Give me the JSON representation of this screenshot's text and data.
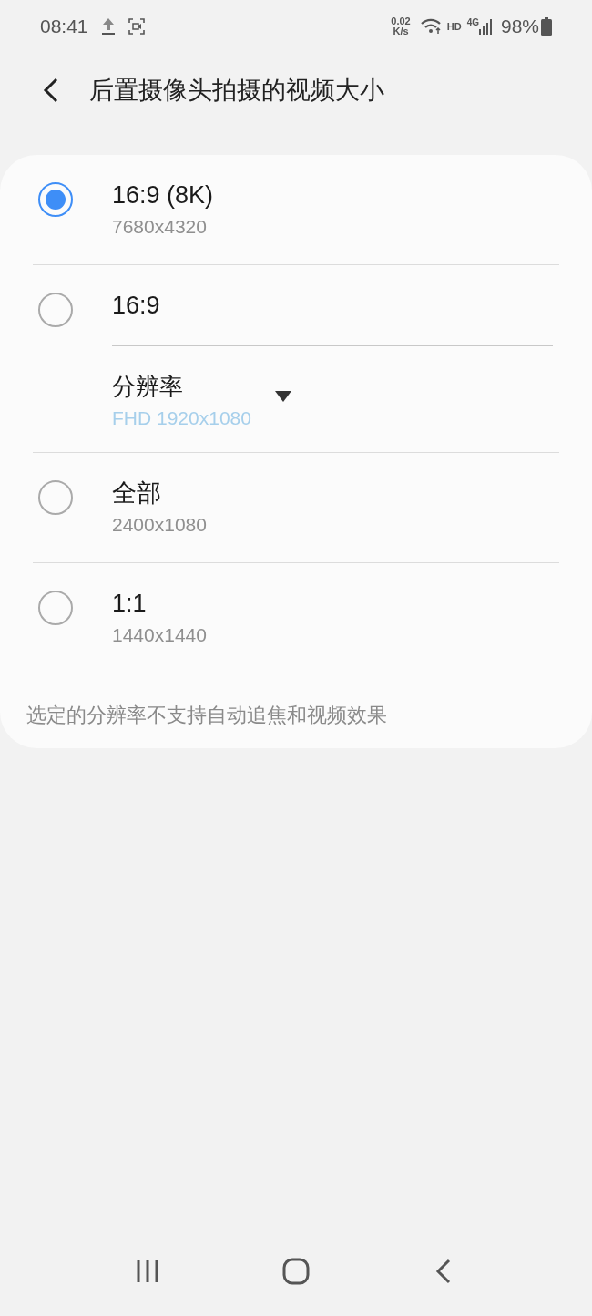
{
  "status_bar": {
    "time": "08:41",
    "net_speed": [
      "0.02",
      "K/s"
    ],
    "hd": "HD",
    "network": "4G",
    "battery": "98%"
  },
  "header": {
    "title": "后置摄像头拍摄的视频大小"
  },
  "options": [
    {
      "kind": "radio",
      "title": "16:9 (8K)",
      "subtitle": "7680x4320",
      "selected": true
    },
    {
      "kind": "radio",
      "title": "16:9",
      "selected": false,
      "resolution": {
        "label": "分辨率",
        "value": "FHD 1920x1080",
        "disabled": true
      }
    },
    {
      "kind": "radio",
      "title": "全部",
      "subtitle": "2400x1080",
      "selected": false
    },
    {
      "kind": "radio",
      "title": "1:1",
      "subtitle": "1440x1440",
      "selected": false
    }
  ],
  "note": "选定的分辨率不支持自动追焦和视频效果"
}
